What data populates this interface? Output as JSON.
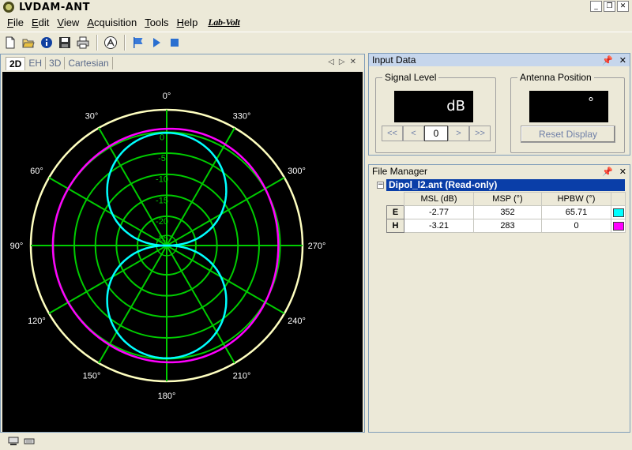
{
  "window": {
    "title": "LVDAM-ANT"
  },
  "menu": [
    "File",
    "Edit",
    "View",
    "Acquisition",
    "Tools",
    "Help"
  ],
  "brand": "Lab-Volt",
  "toolbar": {
    "icons": [
      "new-file-icon",
      "open-folder-icon",
      "info-icon",
      "save-icon",
      "print-icon",
      "antenna-icon",
      "flag-icon",
      "play-icon",
      "stop-icon"
    ]
  },
  "tabs": [
    "2D",
    "EH",
    "3D",
    "Cartesian"
  ],
  "plot": {
    "angle_labels": [
      "0°",
      "330°",
      "300°",
      "270°",
      "240°",
      "210°",
      "180°",
      "150°",
      "120°",
      "90°",
      "60°",
      "30°"
    ],
    "ring_labels": [
      "0",
      "-5",
      "-10",
      "-15",
      "-20",
      "-25"
    ],
    "colors": {
      "grid": "#00cc00",
      "outer": "#ffffc0",
      "E": "#00ffff",
      "H": "#ff00ff"
    }
  },
  "input_data": {
    "title": "Input Data",
    "signal_level": {
      "label": "Signal Level",
      "unit": "dB",
      "value": "0",
      "buttons": [
        "<<",
        "<",
        ">",
        ">>"
      ]
    },
    "antenna_position": {
      "label": "Antenna Position",
      "unit": "°",
      "reset_label": "Reset Display"
    }
  },
  "file_manager": {
    "title": "File Manager",
    "filename": "Dipol_l2.ant (Read-only)",
    "columns": [
      "MSL (dB)",
      "MSP (°)",
      "HPBW (°)"
    ],
    "rows": [
      {
        "name": "E",
        "msl": "-2.77",
        "msp": "352",
        "hpbw": "65.71",
        "color": "#00ffff"
      },
      {
        "name": "H",
        "msl": "-3.21",
        "msp": "283",
        "hpbw": "0",
        "color": "#ff00ff"
      }
    ]
  }
}
